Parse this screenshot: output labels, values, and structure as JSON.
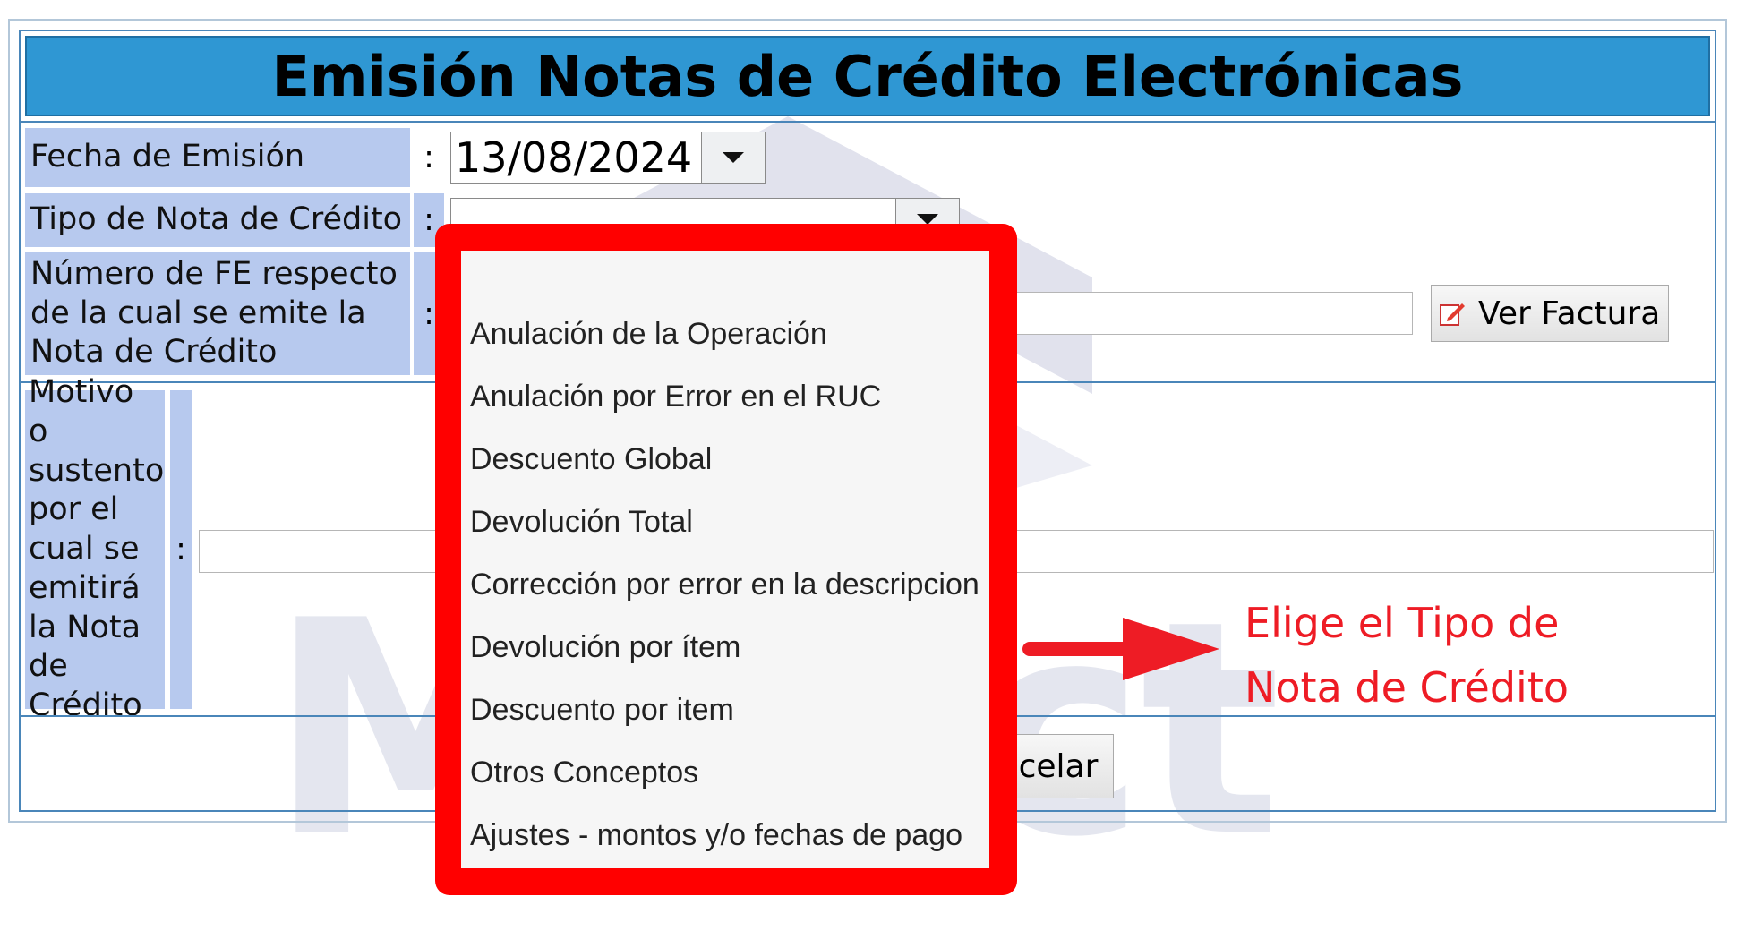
{
  "form": {
    "title": "Emisión Notas de Crédito Electrónicas",
    "fecha_label": "Fecha de Emisión",
    "fecha_value": "13/08/2024",
    "tipo_label": "Tipo de Nota de Crédito",
    "fe_label_lines": [
      "Número de FE respecto",
      "de la cual se emite la",
      "Nota de Crédito"
    ],
    "motivo_label_lines": [
      "Motivo o",
      "sustento",
      "por el",
      "cual se",
      "emitirá",
      "la Nota",
      "de",
      "Crédito"
    ],
    "colon": ":",
    "ver_factura_label": "Ver Factura",
    "cancel_label_visible": "celar"
  },
  "dropdown": {
    "options": [
      "",
      "Anulación de la Operación",
      "Anulación por Error en el RUC",
      "Descuento Global",
      "Devolución Total",
      "Corrección por error en la descripcion",
      "Devolución por ítem",
      "Descuento por item",
      "Otros Conceptos",
      "Ajustes - montos y/o fechas de pago"
    ]
  },
  "annotation": {
    "lines": [
      "Elige el Tipo de",
      "Nota de Crédito"
    ],
    "color": "#ee1c25"
  },
  "watermark": {
    "text": "Mifact"
  },
  "colors": {
    "title_bar": "#2f97d3",
    "label_bg": "#b7c9ee",
    "border": "#4a86b9",
    "highlight": "#ff0000"
  }
}
